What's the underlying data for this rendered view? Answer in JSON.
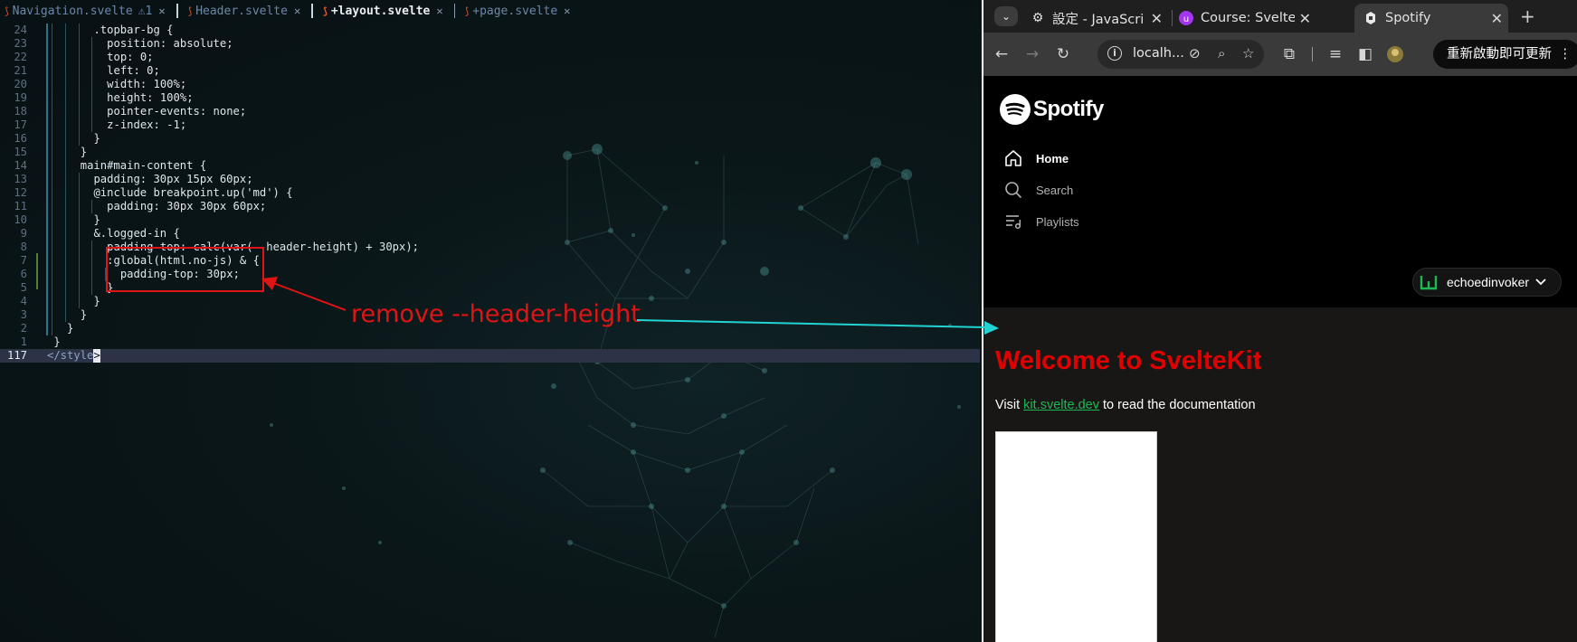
{
  "editor": {
    "tabs": [
      {
        "label": "Navigation.svelte",
        "warn": "⚠1",
        "active": false
      },
      {
        "label": "Header.svelte",
        "active": false
      },
      {
        "label": "+layout.svelte",
        "active": true
      },
      {
        "label": "+page.svelte",
        "active": false
      }
    ],
    "lines": [
      {
        "num": "24",
        "indent": 7,
        "text": ".topbar-bg {"
      },
      {
        "num": "23",
        "indent": 9,
        "text": "position: absolute;"
      },
      {
        "num": "22",
        "indent": 9,
        "text": "top: 0;"
      },
      {
        "num": "21",
        "indent": 9,
        "text": "left: 0;"
      },
      {
        "num": "20",
        "indent": 9,
        "text": "width: 100%;"
      },
      {
        "num": "19",
        "indent": 9,
        "text": "height: 100%;"
      },
      {
        "num": "18",
        "indent": 9,
        "text": "pointer-events: none;"
      },
      {
        "num": "17",
        "indent": 9,
        "text": "z-index: -1;"
      },
      {
        "num": "16",
        "indent": 7,
        "text": "}"
      },
      {
        "num": "15",
        "indent": 5,
        "text": "}"
      },
      {
        "num": "14",
        "indent": 5,
        "text": "main#main-content {"
      },
      {
        "num": "13",
        "indent": 7,
        "text": "padding: 30px 15px 60px;"
      },
      {
        "num": "12",
        "indent": 7,
        "text": "@include breakpoint.up('md') {"
      },
      {
        "num": "11",
        "indent": 9,
        "text": "padding: 30px 30px 60px;"
      },
      {
        "num": "10",
        "indent": 7,
        "text": "}"
      },
      {
        "num": "9",
        "indent": 7,
        "text": "&.logged-in {"
      },
      {
        "num": "8",
        "indent": 9,
        "text": "padding-top: calc(var(--header-height) + 30px);"
      },
      {
        "num": "7",
        "indent": 9,
        "text": ":global(html.no-js) & {"
      },
      {
        "num": "6",
        "indent": 11,
        "text": "padding-top: 30px;"
      },
      {
        "num": "5",
        "indent": 9,
        "text": "}"
      },
      {
        "num": "4",
        "indent": 7,
        "text": "}"
      },
      {
        "num": "3",
        "indent": 5,
        "text": "}"
      },
      {
        "num": "2",
        "indent": 3,
        "text": "}"
      },
      {
        "num": "1",
        "indent": 1,
        "text": "}"
      }
    ],
    "cursor_line": {
      "num": "117",
      "text": "</style",
      "caret": ">"
    },
    "annotation": "remove --header-height"
  },
  "browser": {
    "tabs": [
      {
        "title": "設定 - JavaScript",
        "icon": "gear-icon"
      },
      {
        "title": "Course: Svelte &",
        "icon": "course-icon"
      },
      {
        "title": "Spotify",
        "icon": "svelte-icon",
        "active": true
      }
    ],
    "url": "localh...",
    "restart_label": "重新啟動即可更新",
    "page": {
      "logo_text": "Spotify",
      "nav": [
        {
          "label": "Home",
          "icon": "home-icon",
          "active": true
        },
        {
          "label": "Search",
          "icon": "search-icon",
          "active": false
        },
        {
          "label": "Playlists",
          "icon": "playlists-icon",
          "active": false
        }
      ],
      "username": "echoedinvoker",
      "welcome_title": "Welcome to SvelteKit",
      "visit_prefix": "Visit ",
      "visit_link": "kit.svelte.dev",
      "visit_suffix": " to read the documentation"
    }
  },
  "colors": {
    "annotation_red": "#e01414",
    "arrow_cyan": "#22d3d3",
    "spotify_green": "#1db954",
    "welcome_red": "#e00000"
  }
}
